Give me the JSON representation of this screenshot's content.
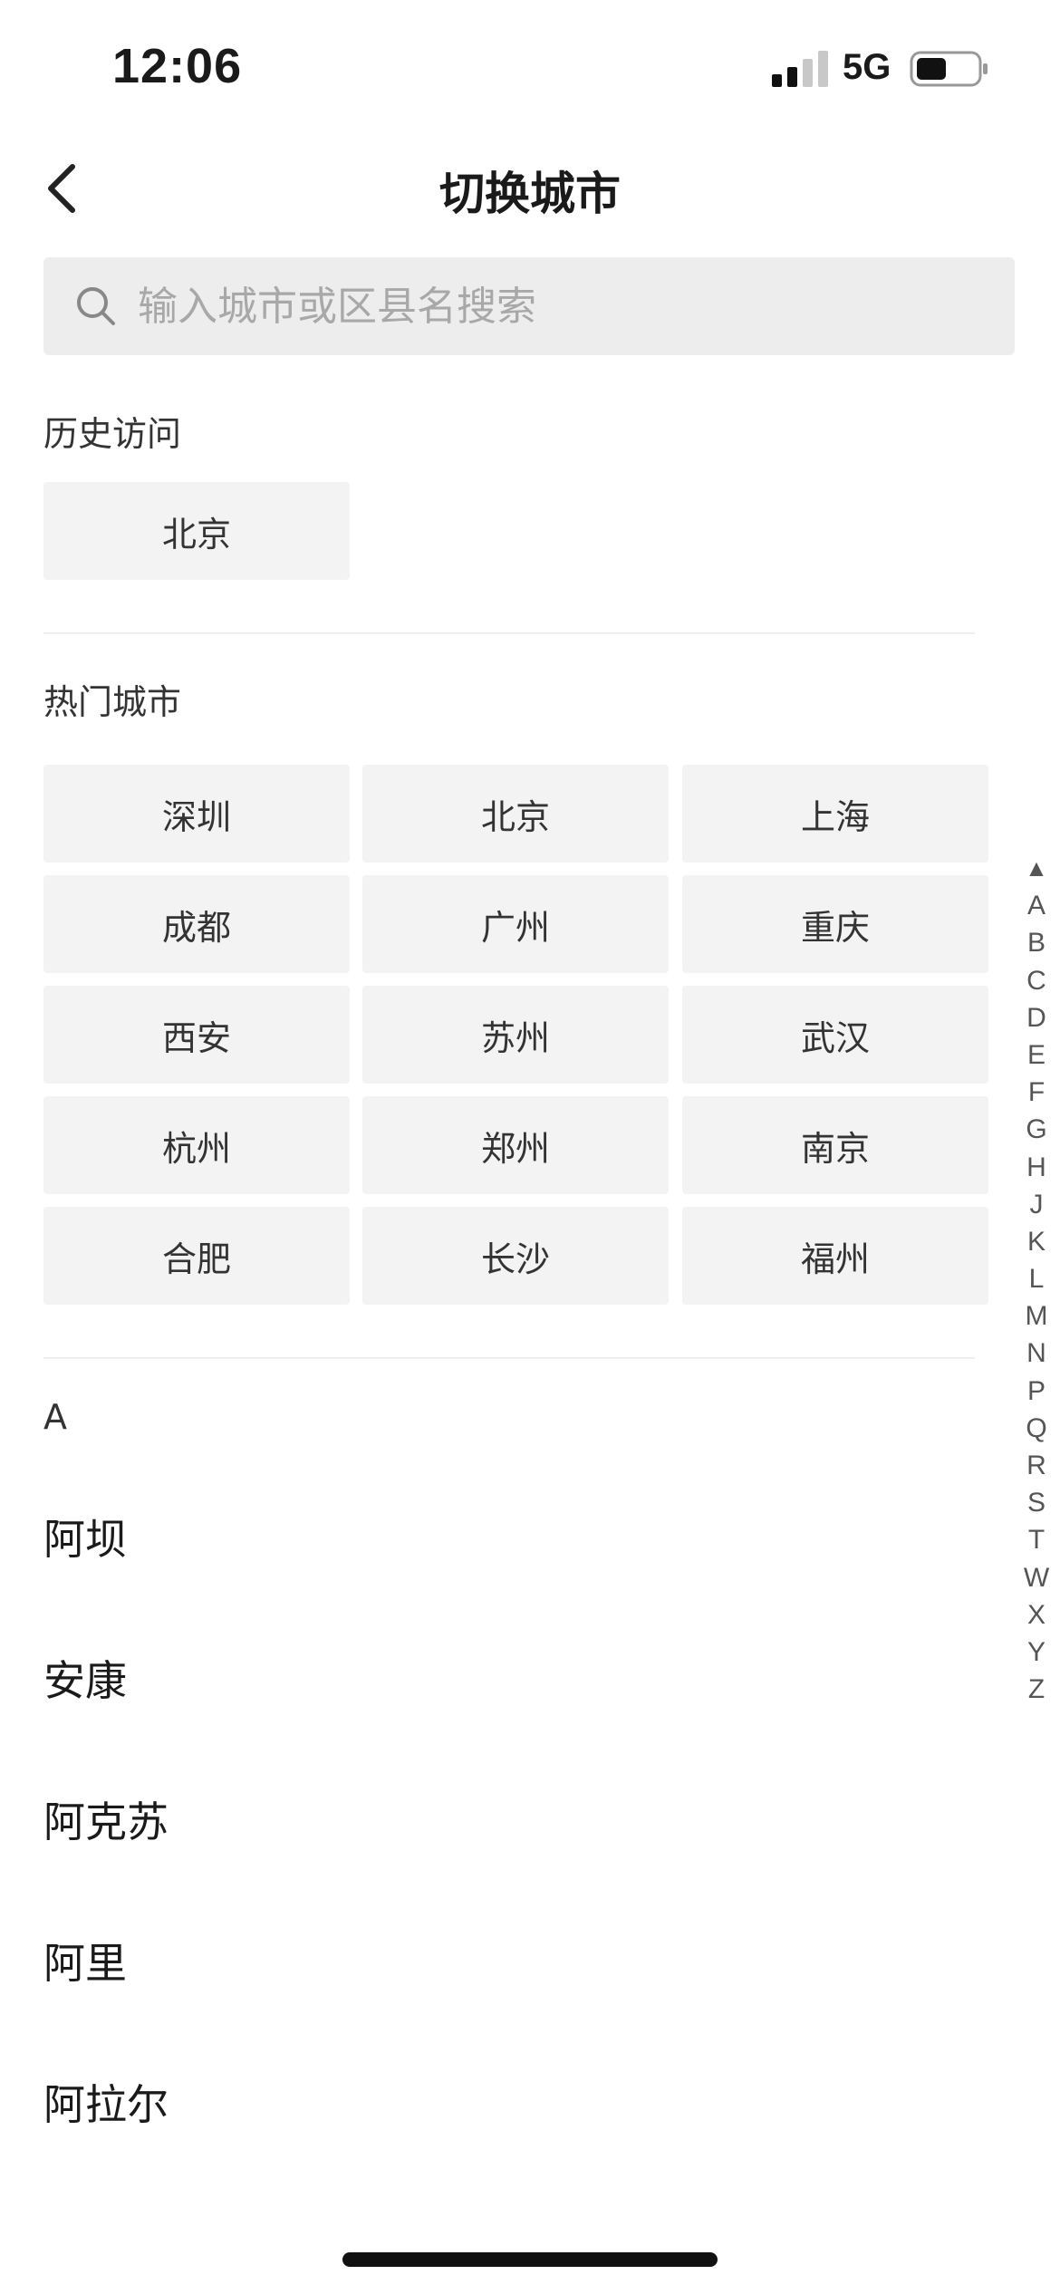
{
  "status_bar": {
    "time": "12:06",
    "network": "5G"
  },
  "nav": {
    "title": "切换城市"
  },
  "search": {
    "placeholder": "输入城市或区县名搜索"
  },
  "history": {
    "title": "历史访问",
    "cities": [
      "北京"
    ]
  },
  "hot": {
    "title": "热门城市",
    "cities": [
      "深圳",
      "北京",
      "上海",
      "成都",
      "广州",
      "重庆",
      "西安",
      "苏州",
      "武汉",
      "杭州",
      "郑州",
      "南京",
      "合肥",
      "长沙",
      "福州"
    ]
  },
  "list": {
    "letter": "A",
    "cities": [
      "阿坝",
      "安康",
      "阿克苏",
      "阿里",
      "阿拉尔"
    ]
  },
  "alphabet_index": [
    "▲",
    "A",
    "B",
    "C",
    "D",
    "E",
    "F",
    "G",
    "H",
    "J",
    "K",
    "L",
    "M",
    "N",
    "P",
    "Q",
    "R",
    "S",
    "T",
    "W",
    "X",
    "Y",
    "Z"
  ]
}
